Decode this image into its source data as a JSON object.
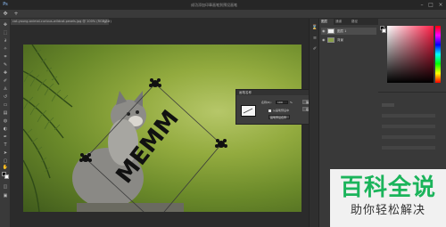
{
  "titlebar": {
    "app_icon": "Ps",
    "title": "成功添加印章画笔到预设画笔"
  },
  "document_tab": {
    "label": "cat-young-animal-curious-wildcat-pexels.jpg @ 100% (RGB/8#)",
    "close": "×"
  },
  "canvas": {
    "stamp_text": "MEMM"
  },
  "dialog": {
    "title": "画笔名称",
    "close": "×",
    "name_label": "名称(N):",
    "name_value": "100",
    "unit": "%",
    "ok_label": "确定",
    "cancel_label": "取消",
    "option_label": "从画笔预设中",
    "select_value": "画笔预设名称"
  },
  "layers_panel": {
    "tabs": [
      "图层",
      "通道",
      "路径"
    ],
    "layers": [
      {
        "name": "图层 1"
      },
      {
        "name": "背景"
      }
    ]
  },
  "watermark": {
    "title": "百科全说",
    "subtitle": "助你轻松解决"
  }
}
